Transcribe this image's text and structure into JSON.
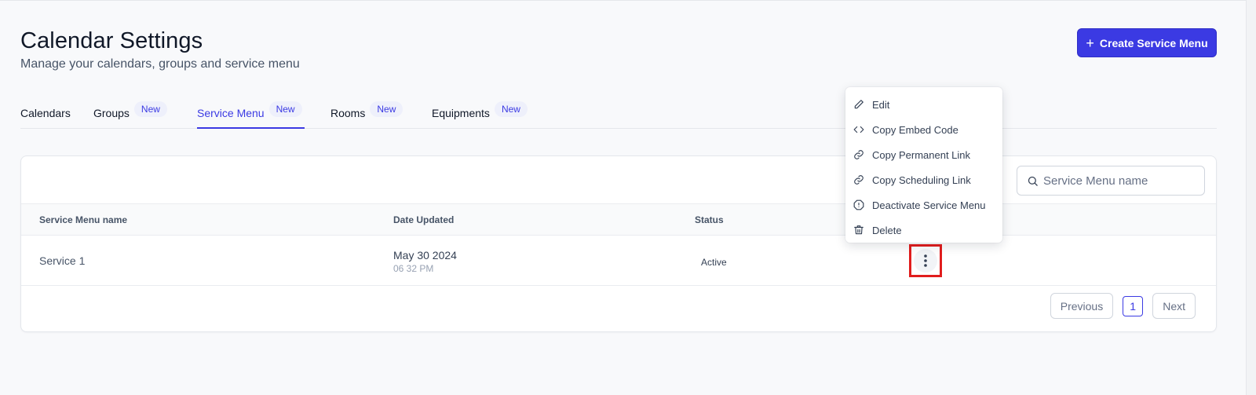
{
  "header": {
    "title": "Calendar Settings",
    "subtitle": "Manage your calendars, groups and service menu",
    "create_button": "Create Service Menu"
  },
  "tabs": [
    {
      "label": "Calendars",
      "badge": ""
    },
    {
      "label": "Groups",
      "badge": "New"
    },
    {
      "label": "Service Menu",
      "badge": "New",
      "active": true
    },
    {
      "label": "Rooms",
      "badge": "New"
    },
    {
      "label": "Equipments",
      "badge": "New"
    }
  ],
  "search": {
    "placeholder": "Service Menu name"
  },
  "table": {
    "columns": [
      "Service Menu name",
      "Date Updated",
      "Status"
    ],
    "rows": [
      {
        "name": "Service 1",
        "date": "May 30 2024",
        "time": "06 32 PM",
        "status": "Active"
      }
    ]
  },
  "pagination": {
    "previous": "Previous",
    "page": "1",
    "next": "Next"
  },
  "menu": {
    "items": [
      {
        "label": "Edit",
        "icon": "pencil-icon"
      },
      {
        "label": "Copy Embed Code",
        "icon": "code-icon"
      },
      {
        "label": "Copy Permanent Link",
        "icon": "link-icon"
      },
      {
        "label": "Copy Scheduling Link",
        "icon": "link-icon"
      },
      {
        "label": "Deactivate Service Menu",
        "icon": "octagon-alert-icon"
      },
      {
        "label": "Delete",
        "icon": "trash-icon"
      }
    ]
  },
  "colors": {
    "accent": "#3b3ae3",
    "highlight": "#e11d1d"
  }
}
